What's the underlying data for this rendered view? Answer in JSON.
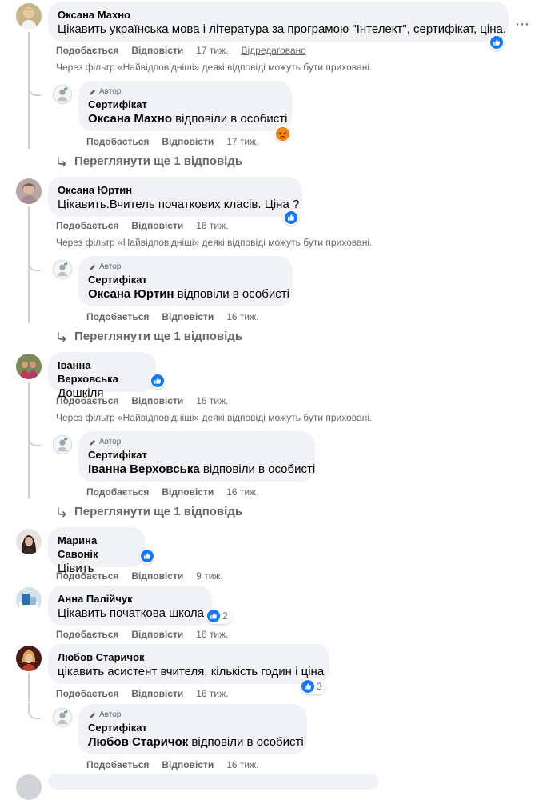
{
  "ui": {
    "like": "Подобається",
    "reply": "Відповісти",
    "edited": "Відредаговано",
    "filter_note": "Через фільтр «Найвідповідніші» деякі відповіді можуть бути приховані.",
    "more_replies": "Переглянути ще 1 відповідь",
    "author_badge": "Автор",
    "author_name": "Сертифікат",
    "replied_private": "відповіли в особисті",
    "more_icon": "⋯"
  },
  "colors": {
    "bubble": "#f0f2f5",
    "secondary_text": "#65676b",
    "like_blue": "#1877f2",
    "angry_orange": "#e9710f"
  },
  "comments": [
    {
      "name": "Оксана Махно",
      "text": "Цікавить українська мова і література за програмою \"Інтелект\", сертифікат, ціна.",
      "time": "17 тиж.",
      "reaction": "like",
      "reply": {
        "name": "Оксана Махно",
        "time": "17 тиж.",
        "reaction": "angry"
      }
    },
    {
      "name": "Оксана Юртин",
      "text": "Цікавить.Вчитель початкових класів. Ціна ?",
      "time": "16 тиж.",
      "reaction": "like",
      "reply": {
        "name": "Оксана Юртин",
        "time": "16 тиж."
      }
    },
    {
      "name": "Іванна Верховська",
      "text": "Дошкіля",
      "time": "16 тиж.",
      "reaction": "like",
      "reply": {
        "name": "Іванна Верховська",
        "time": "16 тиж."
      }
    },
    {
      "name": "Марина Савонік",
      "text": "Цівить",
      "time": "9 тиж.",
      "reaction": "like"
    },
    {
      "name": "Анна Палійчук",
      "text": "Цікавить початкова школа",
      "time": "16 тиж.",
      "reaction": "like",
      "reaction_count": "2"
    },
    {
      "name": "Любов Старичок",
      "text": "цікавить асистент вчителя, кількість годин і ціна",
      "time": "16 тиж.",
      "reaction": "like",
      "reaction_count": "3",
      "reply": {
        "name": "Любов Старичок",
        "time": "16 тиж."
      }
    }
  ]
}
